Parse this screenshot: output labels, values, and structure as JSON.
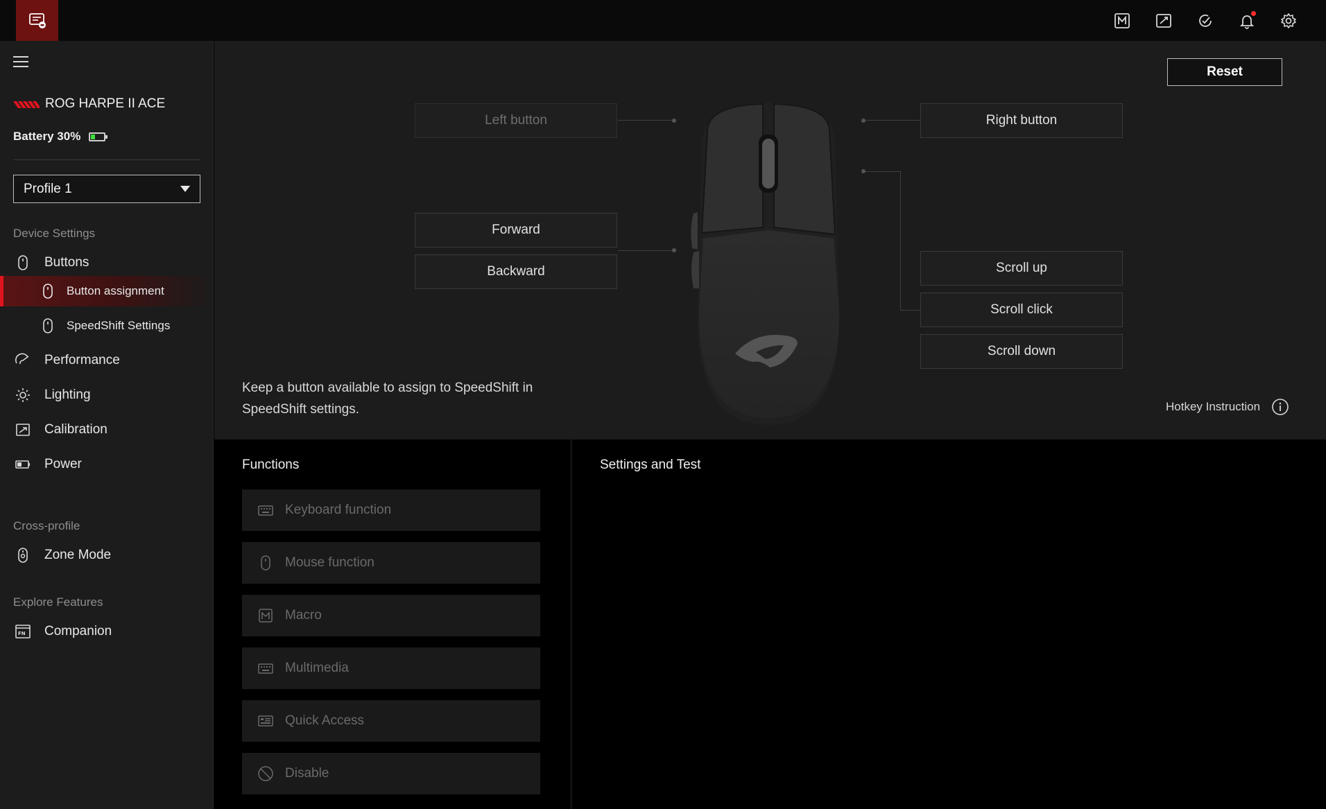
{
  "device": {
    "name": "ROG HARPE II ACE",
    "battery_label": "Battery 30%",
    "battery_level": 0.3
  },
  "profile": {
    "selected": "Profile 1"
  },
  "sidebar": {
    "section_device": "Device Settings",
    "buttons": "Buttons",
    "button_assignment": "Button assignment",
    "speedshift_settings": "SpeedShift Settings",
    "performance": "Performance",
    "lighting": "Lighting",
    "calibration": "Calibration",
    "power": "Power",
    "section_cross": "Cross-profile",
    "zone_mode": "Zone Mode",
    "section_explore": "Explore Features",
    "companion": "Companion"
  },
  "main": {
    "reset_label": "Reset",
    "left_button": "Left button",
    "right_button": "Right button",
    "forward": "Forward",
    "backward": "Backward",
    "scroll_up": "Scroll up",
    "scroll_click": "Scroll click",
    "scroll_down": "Scroll down",
    "hint": "Keep a button available to assign to SpeedShift in SpeedShift settings.",
    "hotkey_label": "Hotkey Instruction"
  },
  "functions": {
    "title": "Functions",
    "items": [
      "Keyboard function",
      "Mouse function",
      "Macro",
      "Multimedia",
      "Quick Access",
      "Disable"
    ]
  },
  "settings_panel": {
    "title": "Settings and Test"
  },
  "colors": {
    "accent_red": "#e0141e",
    "logo_bg": "#6e1111",
    "battery_green": "#3ddc3d",
    "notification": "#ff2d2d"
  }
}
